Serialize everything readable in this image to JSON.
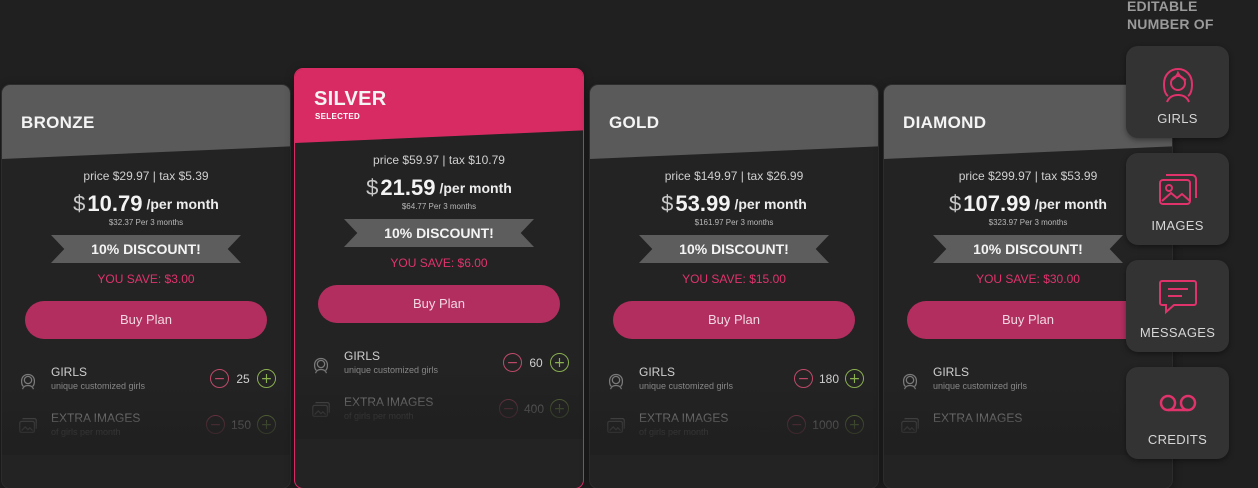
{
  "plans": [
    {
      "name": "BRONZE",
      "subtitle": "",
      "price_line": "price $29.97 | tax $5.39",
      "currency": "$",
      "amount": "10.79",
      "per": "/per month",
      "per3": "$32.37 Per 3 months",
      "discount": "10% DISCOUNT!",
      "save": "YOU SAVE: $3.00",
      "buy": "Buy Plan",
      "features": [
        {
          "name": "GIRLS",
          "desc": "unique customized girls",
          "value": "25"
        },
        {
          "name": "EXTRA IMAGES",
          "desc": "of girls per month",
          "value": "150"
        }
      ]
    },
    {
      "name": "SILVER",
      "subtitle": "SELECTED",
      "price_line": "price $59.97 | tax $10.79",
      "currency": "$",
      "amount": "21.59",
      "per": "/per month",
      "per3": "$64.77 Per 3 months",
      "discount": "10% DISCOUNT!",
      "save": "YOU SAVE: $6.00",
      "buy": "Buy Plan",
      "features": [
        {
          "name": "GIRLS",
          "desc": "unique customized girls",
          "value": "60"
        },
        {
          "name": "EXTRA IMAGES",
          "desc": "of girls per month",
          "value": "400"
        }
      ]
    },
    {
      "name": "GOLD",
      "subtitle": "",
      "price_line": "price $149.97 | tax $26.99",
      "currency": "$",
      "amount": "53.99",
      "per": "/per month",
      "per3": "$161.97 Per 3 months",
      "discount": "10% DISCOUNT!",
      "save": "YOU SAVE: $15.00",
      "buy": "Buy Plan",
      "features": [
        {
          "name": "GIRLS",
          "desc": "unique customized girls",
          "value": "180"
        },
        {
          "name": "EXTRA IMAGES",
          "desc": "of girls per month",
          "value": "1000"
        }
      ]
    },
    {
      "name": "DIAMOND",
      "subtitle": "",
      "price_line": "price $299.97 | tax $53.99",
      "currency": "$",
      "amount": "107.99",
      "per": "/per month",
      "per3": "$323.97 Per 3 months",
      "discount": "10% DISCOUNT!",
      "save": "YOU SAVE: $30.00",
      "buy": "Buy Plan",
      "features": [
        {
          "name": "GIRLS",
          "desc": "unique customized girls",
          "value": ""
        },
        {
          "name": "EXTRA IMAGES",
          "desc": "",
          "value": ""
        }
      ]
    }
  ],
  "stepper": {
    "minus": "−",
    "plus": "+"
  },
  "rail": {
    "title": "EDITABLE NUMBER OF",
    "items": [
      {
        "label": "GIRLS",
        "icon": "girl-icon"
      },
      {
        "label": "IMAGES",
        "icon": "images-icon"
      },
      {
        "label": "MESSAGES",
        "icon": "message-icon"
      },
      {
        "label": "CREDITS",
        "icon": "voicemail-icon"
      }
    ]
  },
  "colors": {
    "background": "#202020",
    "accent": "#d92b63",
    "button": "#b22e5f",
    "header": "#5a5a5a",
    "minus": "#c04a6a",
    "plus": "#8bb050"
  }
}
